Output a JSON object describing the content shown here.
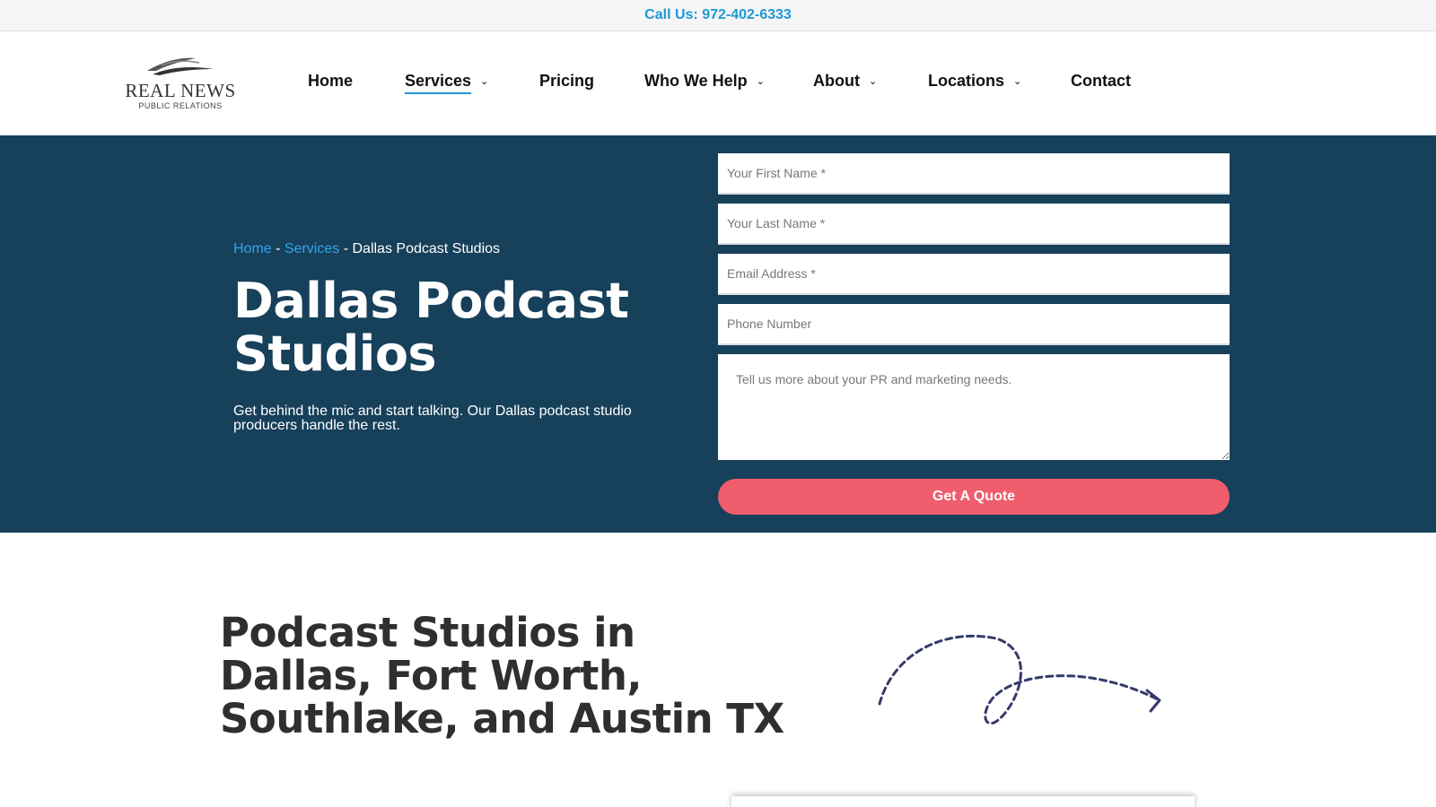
{
  "topbar": {
    "call": "Call Us: 972-402-6333"
  },
  "logo": {
    "brand": "REAL NEWS",
    "sub": "PUBLIC RELATIONS"
  },
  "nav": {
    "home": "Home",
    "services": "Services",
    "pricing": "Pricing",
    "who_we_help": "Who We Help",
    "about": "About",
    "locations": "Locations",
    "contact": "Contact"
  },
  "hero": {
    "breadcrumb": {
      "home": "Home",
      "sep1": " - ",
      "services": "Services",
      "sep2": " - ",
      "current": "Dallas Podcast Studios"
    },
    "title": "Dallas Podcast Studios",
    "subtitle": "Get behind the mic and start talking. Our Dallas podcast studio producers handle the rest."
  },
  "form": {
    "first_name_placeholder": "Your First Name *",
    "last_name_placeholder": "Your Last Name *",
    "email_placeholder": "Email Address *",
    "phone_placeholder": "Phone Number",
    "message_placeholder": "Tell us more about your PR and marketing needs.",
    "submit_label": "Get A Quote"
  },
  "section": {
    "title": "Podcast Studios in Dallas, Fort Worth, Southlake, and Austin TX"
  },
  "colors": {
    "hero_bg": "#17405a",
    "accent_blue": "#1f98d5",
    "cta": "#f05d6c"
  }
}
